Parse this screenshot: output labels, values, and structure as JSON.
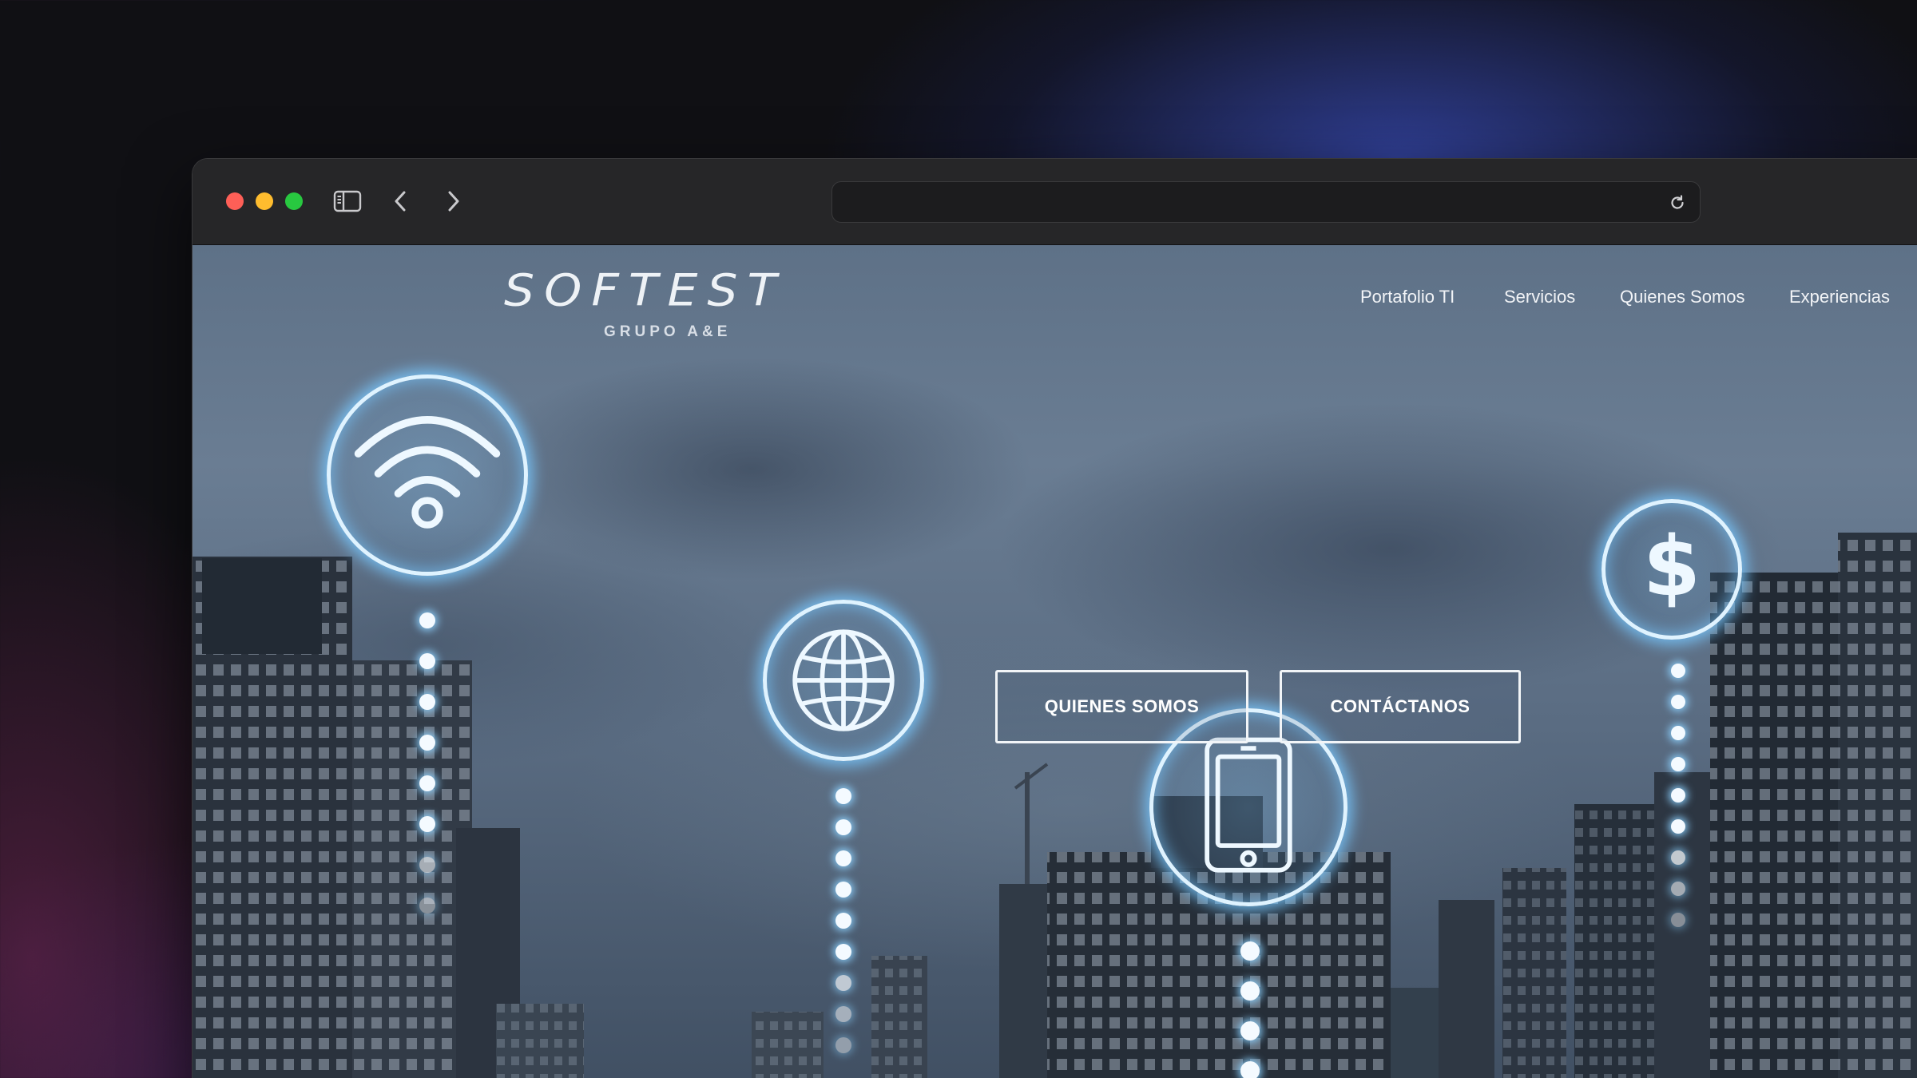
{
  "browser": {
    "url": "",
    "icons": {
      "sidebar": "sidebar-toggle-icon",
      "back": "chevron-left-icon",
      "forward": "chevron-right-icon",
      "reload": "reload-icon"
    }
  },
  "site": {
    "logo": {
      "name": "SOFTEST",
      "tagline": "GRUPO A&E"
    },
    "nav": [
      "Portafolio TI",
      "Servicios",
      "Quienes Somos",
      "Experiencias"
    ],
    "hero": {
      "buttons": [
        "QUIENES SOMOS",
        "CONTÁCTANOS"
      ],
      "icons": [
        "wifi-icon",
        "globe-icon",
        "tablet-icon",
        "dollar-icon"
      ]
    }
  },
  "colors": {
    "accent_glow": "#8fd3ff",
    "traffic_red": "#fe5f57",
    "traffic_yellow": "#febc2e",
    "traffic_green": "#28c840"
  }
}
